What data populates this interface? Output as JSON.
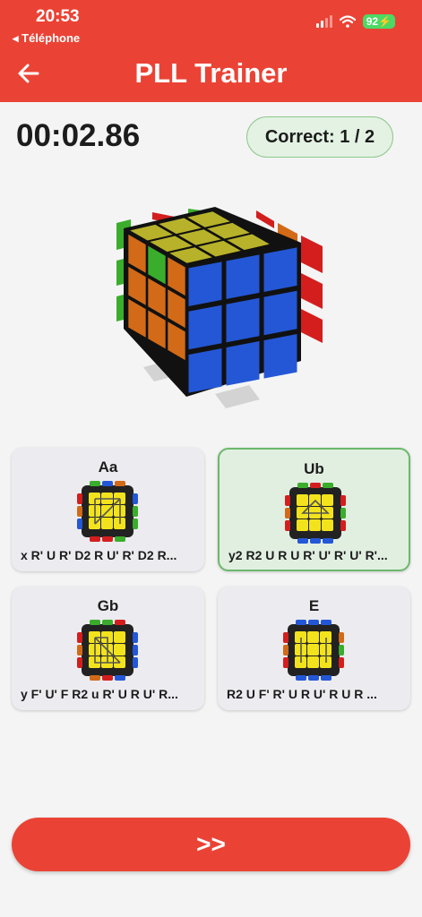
{
  "status_bar": {
    "time": "20:53",
    "back_label": "◂ Téléphone",
    "battery": "92"
  },
  "header": {
    "title": "PLL Trainer"
  },
  "timer": {
    "value": "00:02.86"
  },
  "score": {
    "label": "Correct: 1 / 2"
  },
  "options": [
    {
      "name": "Aa",
      "algorithm": "x R' U R' D2 R U' R' D2 R...",
      "state": "default"
    },
    {
      "name": "Ub",
      "algorithm": "y2 R2 U R U R' U' R' U' R'...",
      "state": "correct"
    },
    {
      "name": "Gb",
      "algorithm": "y F' U' F R2 u R' U R U' R...",
      "state": "default"
    },
    {
      "name": "E",
      "algorithm": "R2 U F' R' U R U' R U R ...",
      "state": "default"
    }
  ],
  "next_button": {
    "label": ">>"
  },
  "colors": {
    "accent": "#ea4335",
    "correct_bg": "#e1efe1",
    "correct_border": "#6cb86c",
    "cube_yellow": "#b7b22a",
    "cube_blue": "#2457d6",
    "cube_orange": "#d26a18",
    "cube_green": "#3aad2c",
    "cube_red": "#d41e1e"
  }
}
